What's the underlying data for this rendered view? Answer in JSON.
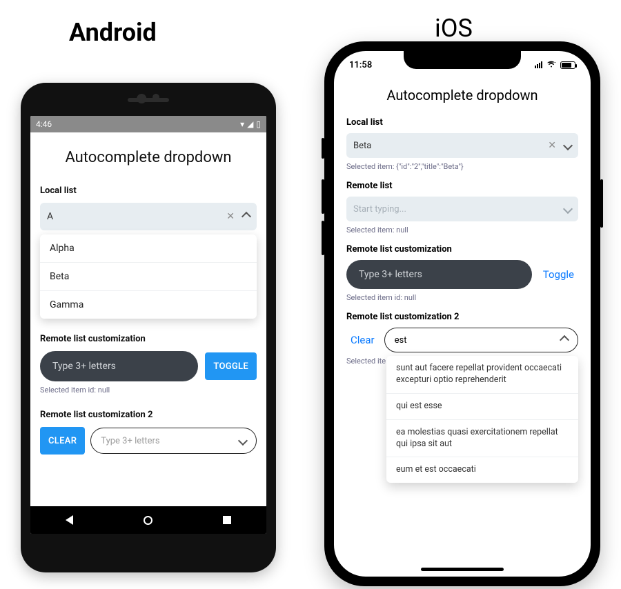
{
  "labels": {
    "android": "Android",
    "ios": "iOS"
  },
  "android": {
    "status": {
      "time": "4:46"
    },
    "title": "Autocomplete dropdown",
    "local": {
      "label": "Local list",
      "value": "A",
      "options": [
        "Alpha",
        "Beta",
        "Gamma"
      ]
    },
    "rcl": {
      "label": "Remote list customization",
      "placeholder": "Type 3+ letters",
      "toggle": "TOGGLE",
      "note": "Selected item id: null"
    },
    "rcl2": {
      "label": "Remote list customization 2",
      "clear": "CLEAR",
      "placeholder": "Type 3+ letters"
    }
  },
  "ios": {
    "status": {
      "time": "11:58"
    },
    "title": "Autocomplete dropdown",
    "local": {
      "label": "Local list",
      "value": "Beta",
      "note": "Selected item: {\"id\":\"2\",\"title\":\"Beta\"}"
    },
    "remote": {
      "label": "Remote list",
      "placeholder": "Start typing...",
      "note": "Selected item: null"
    },
    "rcl": {
      "label": "Remote list customization",
      "placeholder": "Type 3+ letters",
      "toggle": "Toggle",
      "note": "Selected item id: null"
    },
    "rcl2": {
      "label": "Remote list customization 2",
      "clear": "Clear",
      "value": "est",
      "note_prefix": "Selected ite",
      "options": [
        "sunt aut facere repellat provident occaecati excepturi optio reprehenderit",
        "qui est esse",
        "ea molestias quasi exercitationem repellat qui ipsa sit aut",
        "eum et est occaecati"
      ]
    }
  }
}
